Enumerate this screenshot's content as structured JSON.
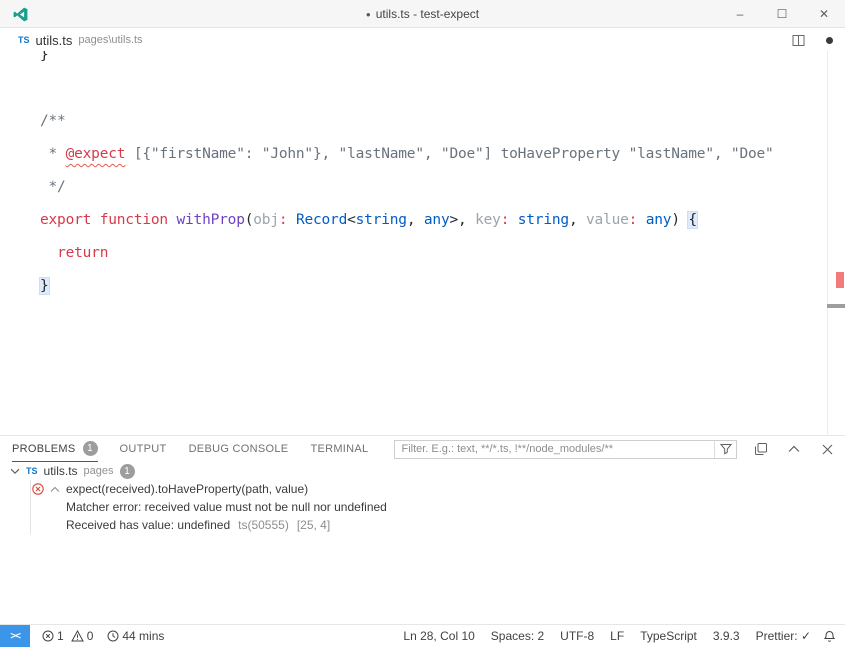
{
  "titlebar": {
    "dot": "●",
    "title": "utils.ts - test-expect",
    "controls": {
      "minimize": "–",
      "maximize": "☐",
      "close": "✕"
    }
  },
  "tabbar": {
    "tab": {
      "badge": "TS",
      "name": "utils.ts",
      "path": "pages\\utils.ts"
    }
  },
  "editor": {
    "code_lines": [
      [
        {
          "t": "}",
          "s": "plain"
        }
      ],
      [],
      [
        {
          "t": "/**",
          "s": "cmt"
        }
      ],
      [
        {
          "t": " * ",
          "s": "cmt"
        },
        {
          "t": "@expect",
          "s": "err"
        },
        {
          "t": " [{\"firstName\": \"John\"}, \"lastName\", \"Doe\"] toHaveProperty \"lastName\", \"Doe\"",
          "s": "cmt"
        }
      ],
      [
        {
          "t": " */",
          "s": "cmt"
        }
      ],
      [
        {
          "t": "export",
          "s": "kw"
        },
        {
          "t": " ",
          "s": "plain"
        },
        {
          "t": "function",
          "s": "kw"
        },
        {
          "t": " ",
          "s": "plain"
        },
        {
          "t": "withProp",
          "s": "fn"
        },
        {
          "t": "(",
          "s": "plain"
        },
        {
          "t": "obj",
          "s": "param"
        },
        {
          "t": ":",
          "s": "kw"
        },
        {
          "t": " ",
          "s": "plain"
        },
        {
          "t": "Record",
          "s": "type"
        },
        {
          "t": "<",
          "s": "plain"
        },
        {
          "t": "string",
          "s": "type"
        },
        {
          "t": ", ",
          "s": "plain"
        },
        {
          "t": "any",
          "s": "type"
        },
        {
          "t": ">, ",
          "s": "plain"
        },
        {
          "t": "key",
          "s": "param"
        },
        {
          "t": ":",
          "s": "kw"
        },
        {
          "t": " ",
          "s": "plain"
        },
        {
          "t": "string",
          "s": "type"
        },
        {
          "t": ", ",
          "s": "plain"
        },
        {
          "t": "value",
          "s": "param"
        },
        {
          "t": ":",
          "s": "kw"
        },
        {
          "t": " ",
          "s": "plain"
        },
        {
          "t": "any",
          "s": "type"
        },
        {
          "t": ") ",
          "s": "plain"
        },
        {
          "t": "{",
          "s": "brkt"
        }
      ],
      [
        {
          "t": "  ",
          "s": "plain"
        },
        {
          "t": "return",
          "s": "kw"
        }
      ],
      [
        {
          "t": "}",
          "s": "brkt"
        }
      ]
    ]
  },
  "panel": {
    "tabs": [
      {
        "label": "PROBLEMS",
        "badge": "1"
      },
      {
        "label": "OUTPUT"
      },
      {
        "label": "DEBUG CONSOLE"
      },
      {
        "label": "TERMINAL"
      }
    ],
    "filter_placeholder": "Filter. E.g.: text, **/*.ts, !**/node_modules/**",
    "file_group": {
      "badge": "TS",
      "file": "utils.ts",
      "dir": "pages",
      "count": "1"
    },
    "problem": {
      "message": "expect(received).toHaveProperty(path, value)",
      "detail1": "Matcher error: received value must not be null nor undefined",
      "detail2": "Received has value: undefined",
      "source": "ts(50555)",
      "position": "[25, 4]"
    }
  },
  "statusbar": {
    "remote_glyph": "><",
    "errors": "1",
    "warnings": "0",
    "timer": "44 mins",
    "right": [
      "Ln 28, Col 10",
      "Spaces: 2",
      "UTF-8",
      "LF",
      "TypeScript",
      "3.9.3",
      "Prettier: ✓"
    ]
  }
}
